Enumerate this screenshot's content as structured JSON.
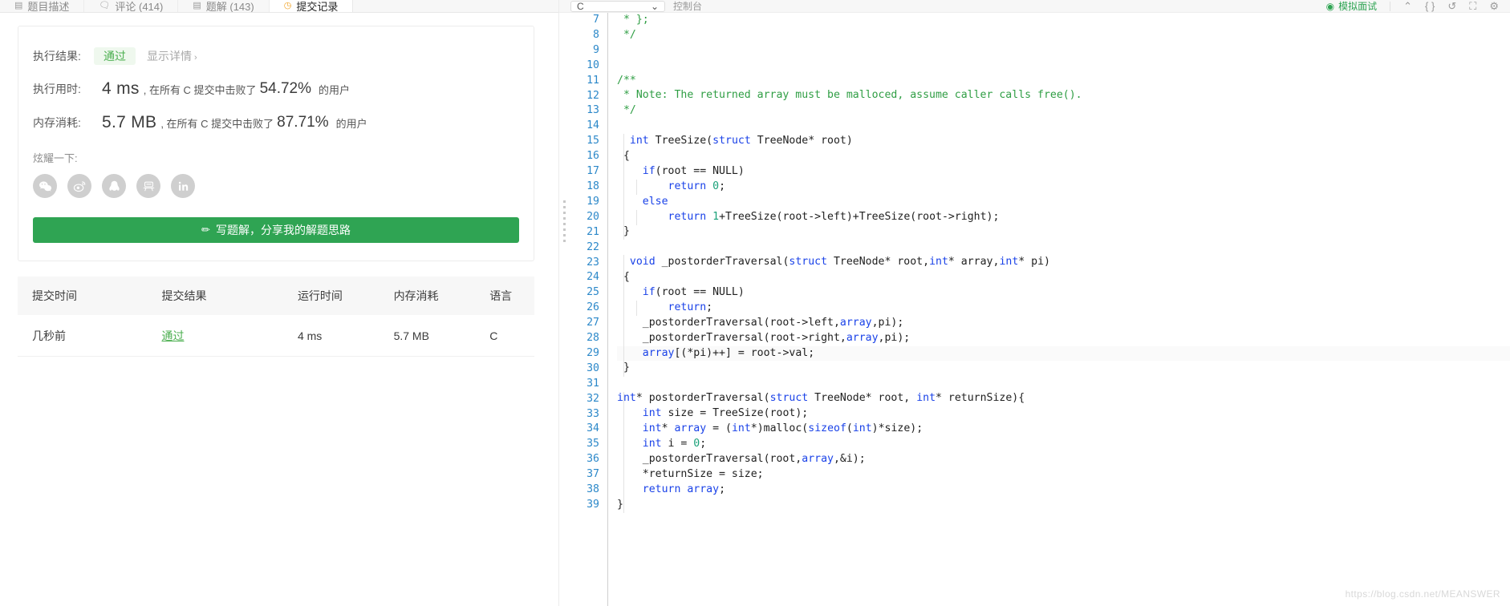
{
  "left": {
    "tabs": [
      {
        "label": "题目描述",
        "icon": "document-icon",
        "active": false
      },
      {
        "label": "评论 (414)",
        "icon": "comment-icon",
        "active": false
      },
      {
        "label": "题解 (143)",
        "icon": "solution-icon",
        "active": false
      },
      {
        "label": "提交记录",
        "icon": "history-icon",
        "active": true
      }
    ],
    "result_card": {
      "result_label": "执行结果:",
      "result_value": "通过",
      "detail_link": "显示详情",
      "detail_chevron": "›",
      "runtime_label": "执行用时:",
      "runtime_value": "4 ms",
      "runtime_tail_before": ", 在所有 C 提交中击败了",
      "runtime_percent": "54.72%",
      "runtime_tail_after": "的用户",
      "memory_label": "内存消耗:",
      "memory_value": "5.7 MB",
      "memory_tail_before": ", 在所有 C 提交中击败了",
      "memory_percent": "87.71%",
      "memory_tail_after": "的用户",
      "share_label": "炫耀一下:",
      "share_icons": [
        "wechat-icon",
        "weibo-icon",
        "qq-icon",
        "qzone-icon",
        "linkedin-icon"
      ],
      "write_button": "写题解，分享我的解题思路",
      "write_button_icon": "pencil-icon"
    },
    "table": {
      "headers": [
        "提交时间",
        "提交结果",
        "运行时间",
        "内存消耗",
        "语言"
      ],
      "rows": [
        {
          "time": "几秒前",
          "result": "通过",
          "runtime": "4 ms",
          "memory": "5.7 MB",
          "language": "C"
        }
      ]
    }
  },
  "editor": {
    "language": "C",
    "toolbar": {
      "console_label": "控制台",
      "run_label": "模拟面试",
      "run_icon": "play-circle-icon",
      "fullscreen_icon": "fullscreen-icon",
      "settings_icon": "gear-icon",
      "format_icon": "format-icon",
      "reset_icon": "reset-icon",
      "collapse_icon": "chevron-icon"
    },
    "first_line_number": 7,
    "lines": [
      {
        "n": 7,
        "tokens": [
          {
            "t": " * };",
            "c": "cm"
          }
        ]
      },
      {
        "n": 8,
        "tokens": [
          {
            "t": " */",
            "c": "cm"
          }
        ]
      },
      {
        "n": 9,
        "tokens": []
      },
      {
        "n": 10,
        "tokens": []
      },
      {
        "n": 11,
        "tokens": [
          {
            "t": "/**",
            "c": "cm"
          }
        ]
      },
      {
        "n": 12,
        "tokens": [
          {
            "t": " * Note: The returned array must be malloced, assume caller calls free().",
            "c": "cm"
          }
        ]
      },
      {
        "n": 13,
        "tokens": [
          {
            "t": " */",
            "c": "cm"
          }
        ]
      },
      {
        "n": 14,
        "tokens": []
      },
      {
        "n": 15,
        "tokens": [
          {
            "t": "  "
          },
          {
            "t": "int",
            "c": "kw"
          },
          {
            "t": " TreeSize("
          },
          {
            "t": "struct",
            "c": "kw"
          },
          {
            "t": " TreeNode* root)"
          }
        ]
      },
      {
        "n": 16,
        "tokens": [
          {
            "t": " {"
          }
        ]
      },
      {
        "n": 17,
        "tokens": [
          {
            "t": "    "
          },
          {
            "t": "if",
            "c": "kw"
          },
          {
            "t": "(root == NULL)"
          }
        ]
      },
      {
        "n": 18,
        "tokens": [
          {
            "t": "        "
          },
          {
            "t": "return",
            "c": "kw"
          },
          {
            "t": " "
          },
          {
            "t": "0",
            "c": "num"
          },
          {
            "t": ";"
          }
        ]
      },
      {
        "n": 19,
        "tokens": [
          {
            "t": "    "
          },
          {
            "t": "else",
            "c": "kw"
          }
        ]
      },
      {
        "n": 20,
        "tokens": [
          {
            "t": "        "
          },
          {
            "t": "return",
            "c": "kw"
          },
          {
            "t": " "
          },
          {
            "t": "1",
            "c": "num"
          },
          {
            "t": "+TreeSize(root->left)+TreeSize(root->right);"
          }
        ]
      },
      {
        "n": 21,
        "tokens": [
          {
            "t": " }"
          }
        ]
      },
      {
        "n": 22,
        "tokens": []
      },
      {
        "n": 23,
        "tokens": [
          {
            "t": "  "
          },
          {
            "t": "void",
            "c": "kw"
          },
          {
            "t": " _postorderTraversal("
          },
          {
            "t": "struct",
            "c": "kw"
          },
          {
            "t": " TreeNode* root,"
          },
          {
            "t": "int",
            "c": "kw"
          },
          {
            "t": "* array,"
          },
          {
            "t": "int",
            "c": "kw"
          },
          {
            "t": "* pi)"
          }
        ]
      },
      {
        "n": 24,
        "tokens": [
          {
            "t": " {"
          }
        ]
      },
      {
        "n": 25,
        "tokens": [
          {
            "t": "    "
          },
          {
            "t": "if",
            "c": "kw"
          },
          {
            "t": "(root == NULL)"
          }
        ]
      },
      {
        "n": 26,
        "tokens": [
          {
            "t": "        "
          },
          {
            "t": "return",
            "c": "kw"
          },
          {
            "t": ";"
          }
        ]
      },
      {
        "n": 27,
        "tokens": [
          {
            "t": "    _postorderTraversal(root->left,"
          },
          {
            "t": "array",
            "c": "id"
          },
          {
            "t": ",pi);"
          }
        ]
      },
      {
        "n": 28,
        "tokens": [
          {
            "t": "    _postorderTraversal(root->right,"
          },
          {
            "t": "array",
            "c": "id"
          },
          {
            "t": ",pi);"
          }
        ]
      },
      {
        "n": 29,
        "tokens": [
          {
            "t": "    "
          },
          {
            "t": "array",
            "c": "id"
          },
          {
            "t": "[(*pi)++] = root->val;"
          }
        ],
        "hl": true
      },
      {
        "n": 30,
        "tokens": [
          {
            "t": " }"
          }
        ]
      },
      {
        "n": 31,
        "tokens": []
      },
      {
        "n": 32,
        "tokens": [
          {
            "t": "int",
            "c": "kw"
          },
          {
            "t": "* postorderTraversal("
          },
          {
            "t": "struct",
            "c": "kw"
          },
          {
            "t": " TreeNode* root, "
          },
          {
            "t": "int",
            "c": "kw"
          },
          {
            "t": "* returnSize){"
          }
        ]
      },
      {
        "n": 33,
        "tokens": [
          {
            "t": "    "
          },
          {
            "t": "int",
            "c": "kw"
          },
          {
            "t": " size = TreeSize(root);"
          }
        ]
      },
      {
        "n": 34,
        "tokens": [
          {
            "t": "    "
          },
          {
            "t": "int",
            "c": "kw"
          },
          {
            "t": "* "
          },
          {
            "t": "array",
            "c": "id"
          },
          {
            "t": " = ("
          },
          {
            "t": "int",
            "c": "kw"
          },
          {
            "t": "*)malloc("
          },
          {
            "t": "sizeof",
            "c": "kw"
          },
          {
            "t": "("
          },
          {
            "t": "int",
            "c": "kw"
          },
          {
            "t": ")*size);"
          }
        ]
      },
      {
        "n": 35,
        "tokens": [
          {
            "t": "    "
          },
          {
            "t": "int",
            "c": "kw"
          },
          {
            "t": " i = "
          },
          {
            "t": "0",
            "c": "num"
          },
          {
            "t": ";"
          }
        ]
      },
      {
        "n": 36,
        "tokens": [
          {
            "t": "    _postorderTraversal(root,"
          },
          {
            "t": "array",
            "c": "id"
          },
          {
            "t": ",&i);"
          }
        ]
      },
      {
        "n": 37,
        "tokens": [
          {
            "t": "    *returnSize = size;"
          }
        ]
      },
      {
        "n": 38,
        "tokens": [
          {
            "t": "    "
          },
          {
            "t": "return",
            "c": "kw"
          },
          {
            "t": " "
          },
          {
            "t": "array",
            "c": "id"
          },
          {
            "t": ";"
          }
        ]
      },
      {
        "n": 39,
        "tokens": [
          {
            "t": "}"
          }
        ]
      }
    ]
  },
  "watermark": "https://blog.csdn.net/MEANSWER"
}
